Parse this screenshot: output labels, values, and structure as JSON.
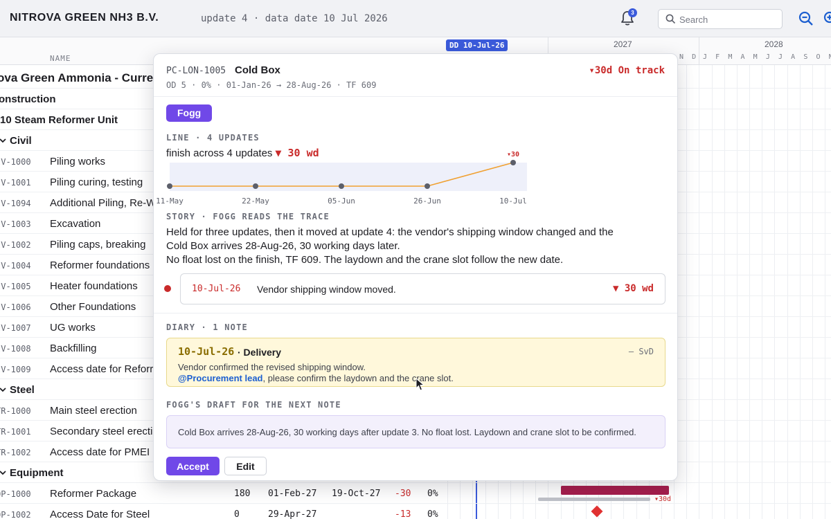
{
  "header": {
    "brand": "NITROVA GREEN NH3 B.V.",
    "update_info": "update 4 · data date 10 Jul 2026",
    "notification_count": "3",
    "search_placeholder": "Search"
  },
  "gantt_header": {
    "column_name": "NAME",
    "data_date_tag": "DD 10-Jul-26",
    "years": [
      "2027",
      "2028"
    ],
    "months_a": [
      "N",
      "D"
    ],
    "months_b": [
      "J",
      "F",
      "M",
      "A",
      "M",
      "J",
      "J",
      "A",
      "S",
      "O",
      "N",
      "D"
    ],
    "months_c": [
      "J",
      "F",
      "M",
      "A",
      "M",
      "J",
      "J",
      "A"
    ]
  },
  "rows": [
    {
      "kind": "title",
      "name": "ova Green Ammonia - Curren"
    },
    {
      "kind": "l1",
      "name": "onstruction"
    },
    {
      "kind": "l2",
      "name": "10 Steam Reformer Unit"
    },
    {
      "kind": "group",
      "name": "Civil"
    },
    {
      "kind": "task",
      "code": "IV-1000",
      "name": "Piling works"
    },
    {
      "kind": "task",
      "code": "IV-1001",
      "name": "Piling curing, testing"
    },
    {
      "kind": "task",
      "code": "IV-1094",
      "name": "Additional Piling, Re-W"
    },
    {
      "kind": "task",
      "code": "IV-1003",
      "name": "Excavation"
    },
    {
      "kind": "task",
      "code": "IV-1002",
      "name": "Piling caps, breaking"
    },
    {
      "kind": "task",
      "code": "IV-1004",
      "name": "Reformer foundations"
    },
    {
      "kind": "task",
      "code": "IV-1005",
      "name": "Heater foundations"
    },
    {
      "kind": "task",
      "code": "IV-1006",
      "name": "Other Foundations"
    },
    {
      "kind": "task",
      "code": "IV-1007",
      "name": "UG works"
    },
    {
      "kind": "task",
      "code": "IV-1008",
      "name": "Backfilling"
    },
    {
      "kind": "task",
      "code": "IV-1009",
      "name": "Access date for Reforr"
    },
    {
      "kind": "group",
      "name": "Steel"
    },
    {
      "kind": "task",
      "code": "TR-1000",
      "name": "Main steel erection"
    },
    {
      "kind": "task",
      "code": "TR-1001",
      "name": "Secondary steel erecti"
    },
    {
      "kind": "task",
      "code": "TR-1002",
      "name": "Access date for PMEI"
    },
    {
      "kind": "group",
      "name": "Equipment"
    },
    {
      "kind": "task",
      "code": "QP-1000",
      "name": "Reformer Package",
      "dur": "180",
      "start": "01-Feb-27",
      "finish": "19-Oct-27",
      "var": "-30",
      "pct": "0%"
    },
    {
      "kind": "task",
      "code": "QP-1002",
      "name": "Access Date for Steel",
      "dur": "0",
      "start": "29-Apr-27",
      "finish": "",
      "var": "-13",
      "pct": "0%"
    }
  ],
  "bar_label": "▾30d",
  "popover": {
    "code": "PC-LON-1005",
    "title": "Cold Box",
    "sub": "OD 5 · 0% · 01-Jan-26 → 28-Aug-26 · TF 609",
    "status": "▾30d On track",
    "pill": "Fogg",
    "line_section": "LINE · 4 UPDATES",
    "line_summary": "finish across 4 updates",
    "line_delta": "▼ 30 wd",
    "story_section": "STORY · FOGG READS THE TRACE",
    "story_lines": [
      "Held for three updates, then it moved at update 4: the vendor's shipping window changed and the",
      "Cold Box arrives 28-Aug-26, 30 working days later.",
      "No float lost on the finish, TF 609. The laydown and the crane slot follow the new date."
    ],
    "event": {
      "date": "10-Jul-26",
      "text": "Vendor shipping window moved.",
      "delta": "▼ 30 wd"
    },
    "diary_section": "DIARY · 1 NOTE",
    "note": {
      "date": "10-Jul-26",
      "category": "· Delivery",
      "author": "— SvD",
      "line1": "Vendor confirmed the revised shipping window.",
      "mention": "@Procurement lead",
      "line2_rest": ", please confirm the laydown and the crane slot."
    },
    "draft_section": "FOGG'S DRAFT FOR THE NEXT NOTE",
    "draft_text": "Cold Box arrives 28-Aug-26, 30 working days after update 3. No float lost. Laydown and crane slot to be confirmed.",
    "accept_label": "Accept",
    "edit_label": "Edit"
  },
  "chart_data": {
    "type": "line",
    "x": [
      "11-May",
      "22-May",
      "05-Jun",
      "26-Jun",
      "10-Jul"
    ],
    "values": [
      0,
      0,
      0,
      0,
      30
    ],
    "annotations": [
      "▾30"
    ],
    "colors": {
      "line": "#f0a030",
      "point": "#5c5f6a",
      "band": "#eef0fa"
    }
  },
  "colors": {
    "accent": "#7048e8",
    "danger": "#c92a2a",
    "data_date": "#3b5bdb",
    "bar": "#a61e4d"
  }
}
